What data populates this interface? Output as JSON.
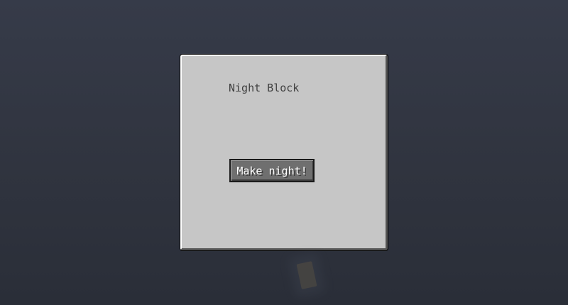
{
  "screen": {
    "title": "Night Block",
    "button_label": "Make night!"
  },
  "colors": {
    "background": "#323744",
    "panel": "#c6c6c6",
    "button": "#6f6f6f",
    "title_text": "#404040",
    "button_text": "#ffffff"
  }
}
